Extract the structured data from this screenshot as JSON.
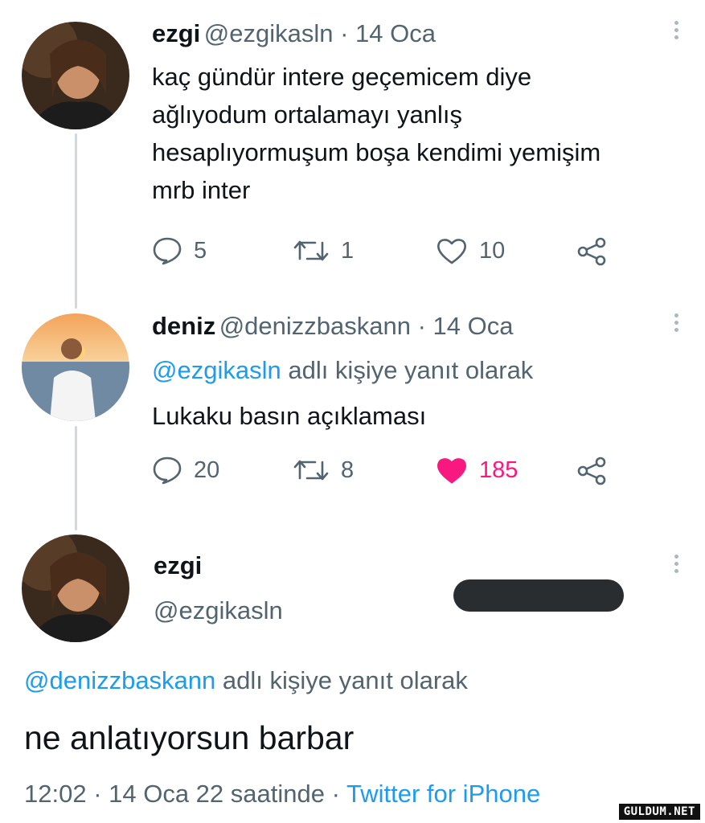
{
  "tweet1": {
    "name": "ezgi",
    "handle_date": "@ezgikasln · 14 Oca",
    "lines": [
      "kaç gündür intere geçemicem diye",
      "ağlıyodum ortalamayı yanlış",
      "hesaplıyormuşum boşa kendimi yemişim",
      "mrb inter"
    ],
    "replies": "5",
    "retweets": "1",
    "likes": "10"
  },
  "tweet2": {
    "name": "deniz",
    "handle_date": "@denizzbaskann · 14 Oca",
    "reply_to_handle": "@ezgikasln",
    "reply_to_suffix": " adlı kişiye yanıt olarak",
    "text": "Lukaku basın açıklaması",
    "replies": "20",
    "retweets": "8",
    "likes": "185",
    "liked": true
  },
  "tweet3": {
    "name": "ezgi",
    "handle": "@ezgikasln",
    "reply_to_handle": "@denizzbaskann",
    "reply_to_suffix": " adlı kişiye yanıt olarak",
    "text": "ne anlatıyorsun barbar",
    "meta": "12:02 · 14 Oca 22 saatinde · ",
    "source": "Twitter for iPhone"
  },
  "watermark": "GULDUM.NET",
  "colors": {
    "link": "#1d9bf0",
    "like_active": "#f91880",
    "muted": "#536471"
  },
  "icons": [
    "reply-icon",
    "retweet-icon",
    "heart-icon",
    "share-icon",
    "more-icon"
  ]
}
